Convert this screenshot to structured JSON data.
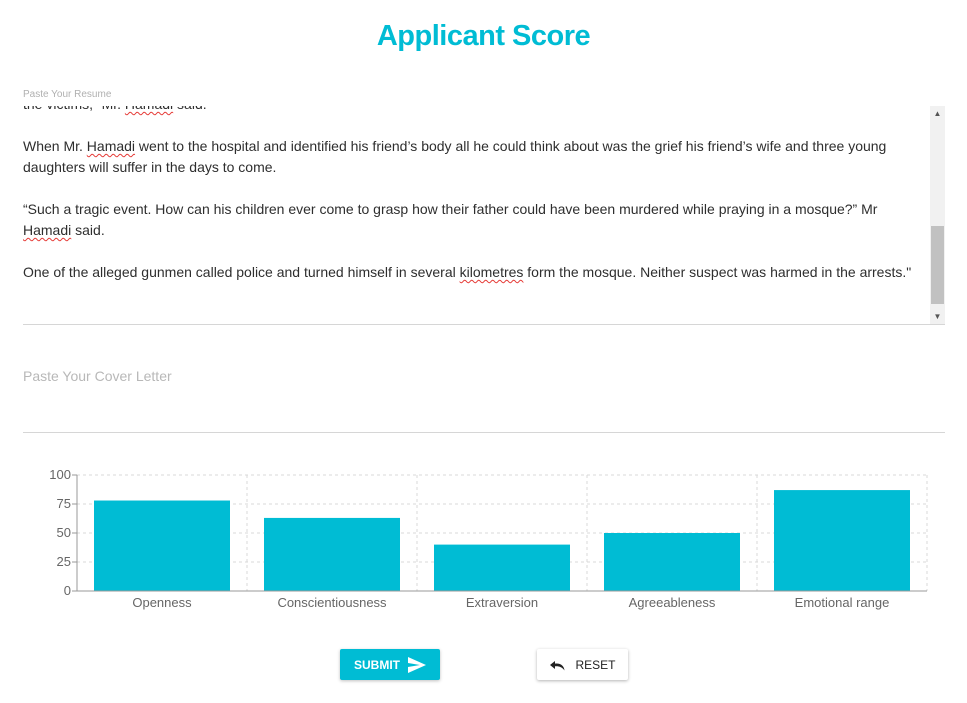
{
  "page": {
    "title": "Applicant Score"
  },
  "resume": {
    "label": "Paste Your Resume",
    "paragraphs": [
      {
        "parts": [
          {
            "t": "the victims,” Mr. "
          },
          {
            "t": "Hamadi",
            "sp": true
          },
          {
            "t": " said."
          }
        ]
      },
      {
        "parts": [
          {
            "t": "When Mr. "
          },
          {
            "t": "Hamadi",
            "sp": true
          },
          {
            "t": " went to the hospital and identified his friend’s body all he could think about was the grief his friend’s wife and three young daughters will suffer in the days to come."
          }
        ]
      },
      {
        "parts": [
          {
            "t": "“Such a tragic event. How can his children ever come to grasp how their father could have been murdered while praying in a mosque?” Mr "
          },
          {
            "t": "Hamadi",
            "sp": true
          },
          {
            "t": " said."
          }
        ]
      },
      {
        "parts": [
          {
            "t": "One of the alleged gunmen called police and turned himself in several "
          },
          {
            "t": "kilometres",
            "sp": true
          },
          {
            "t": " form the mosque. Neither suspect was harmed in the arrests.\""
          }
        ]
      }
    ]
  },
  "cover_letter": {
    "placeholder": "Paste Your Cover Letter",
    "value": ""
  },
  "chart_data": {
    "type": "bar",
    "categories": [
      "Openness",
      "Conscientiousness",
      "Extraversion",
      "Agreeableness",
      "Emotional range"
    ],
    "values": [
      78,
      63,
      40,
      50,
      87
    ],
    "ylim": [
      0,
      100
    ],
    "yticks": [
      0,
      25,
      50,
      75,
      100
    ],
    "grid": true,
    "bar_color": "#00bcd4"
  },
  "buttons": {
    "submit_label": "SUBMIT",
    "reset_label": "RESET"
  },
  "colors": {
    "accent": "#00bcd4"
  },
  "icons": {
    "submit": "send-icon",
    "reset": "undo-icon"
  }
}
